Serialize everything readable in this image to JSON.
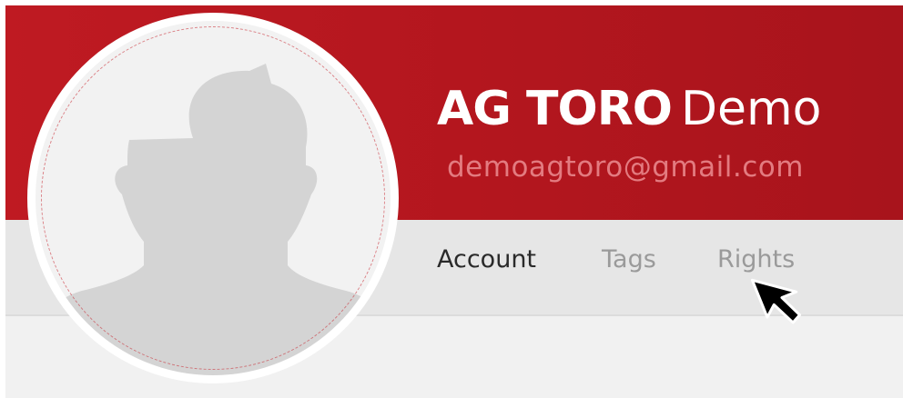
{
  "profile": {
    "name_primary": "AG TORO",
    "name_secondary": "Demo",
    "email": "demoagtoro@gmail.com"
  },
  "tabs": [
    {
      "label": "Account",
      "active": true
    },
    {
      "label": "Tags",
      "active": false
    },
    {
      "label": "Rights",
      "active": false
    }
  ],
  "icons": {
    "avatar": "default-user-silhouette-icon",
    "cursor": "mouse-pointer-icon"
  },
  "colors": {
    "banner": "#b3161e",
    "email_text": "#e37b80",
    "active_tab": "#2a2a2a",
    "inactive_tab": "#9a9a9a",
    "tab_bar": "#e6e6e6",
    "avatar_silhouette": "#d4d4d4"
  }
}
